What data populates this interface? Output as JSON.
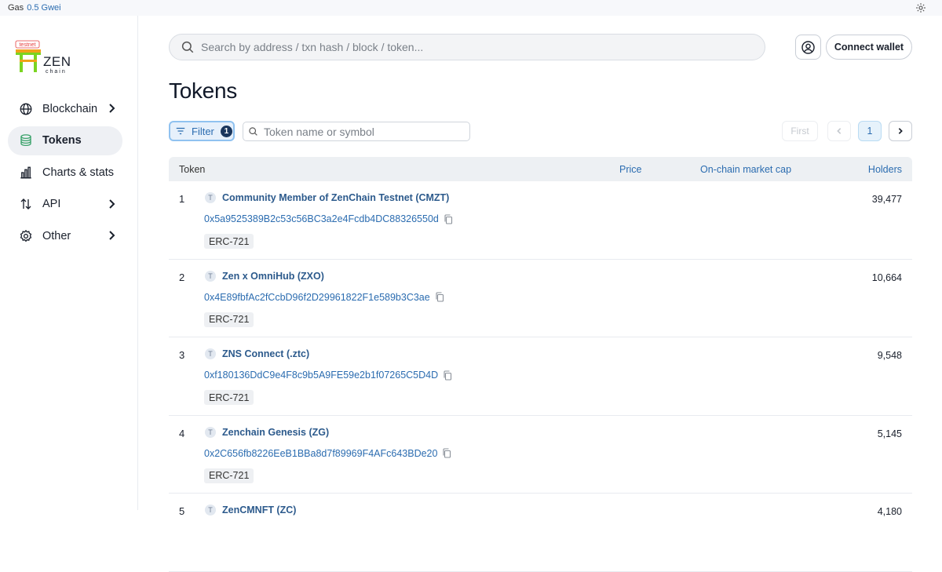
{
  "topbar": {
    "gas_label": "Gas",
    "gas_value": "0.5 Gwei"
  },
  "logo": {
    "badge": "testnet",
    "brand": "ZEN",
    "sub": "chain"
  },
  "sidebar": {
    "items": [
      {
        "label": "Blockchain",
        "icon": "globe-icon",
        "has_chevron": true,
        "active": false
      },
      {
        "label": "Tokens",
        "icon": "coins-stack-icon",
        "has_chevron": false,
        "active": true
      },
      {
        "label": "Charts & stats",
        "icon": "bar-chart-icon",
        "has_chevron": false,
        "active": false
      },
      {
        "label": "API",
        "icon": "arrows-updown-icon",
        "has_chevron": true,
        "active": false
      },
      {
        "label": "Other",
        "icon": "gear-icon",
        "has_chevron": true,
        "active": false
      }
    ]
  },
  "header": {
    "search_placeholder": "Search by address / txn hash / block / token...",
    "connect_wallet": "Connect wallet"
  },
  "page": {
    "title": "Tokens"
  },
  "toolbar": {
    "filter_label": "Filter",
    "filter_count": "1",
    "token_search_placeholder": "Token name or symbol"
  },
  "pagination": {
    "first": "First",
    "current": "1"
  },
  "table": {
    "columns": {
      "token": "Token",
      "price": "Price",
      "market_cap": "On-chain market cap",
      "holders": "Holders"
    },
    "rows": [
      {
        "rank": "1",
        "icon_letter": "T",
        "name": "Community Member of ZenChain Testnet (CMZT)",
        "address": "0x5a9525389B2c53c56BC3a2e4Fcdb4DC88326550d",
        "type": "ERC-721",
        "holders": "39,477"
      },
      {
        "rank": "2",
        "icon_letter": "T",
        "name": "Zen x OmniHub (ZXO)",
        "address": "0x4E89fbfAc2fCcbD96f2D29961822F1e589b3C3ae",
        "type": "ERC-721",
        "holders": "10,664"
      },
      {
        "rank": "3",
        "icon_letter": "T",
        "name": "ZNS Connect (.ztc)",
        "address": "0xf180136DdC9e4F8c9b5A9FE59e2b1f07265C5D4D",
        "type": "ERC-721",
        "holders": "9,548"
      },
      {
        "rank": "4",
        "icon_letter": "T",
        "name": "Zenchain Genesis (ZG)",
        "address": "0x2C656fb8226EeB1BBa8d7f89969F4AFc643BDe20",
        "type": "ERC-721",
        "holders": "5,145"
      },
      {
        "rank": "5",
        "icon_letter": "T",
        "name": "ZenCMNFT (ZC)",
        "address": "",
        "type": "",
        "holders": "4,180"
      }
    ]
  },
  "colors": {
    "accent": "#2b6cb0",
    "active_bg": "#eef0f4",
    "logo_green": "#7bd421",
    "logo_orange": "#f0a21a"
  }
}
